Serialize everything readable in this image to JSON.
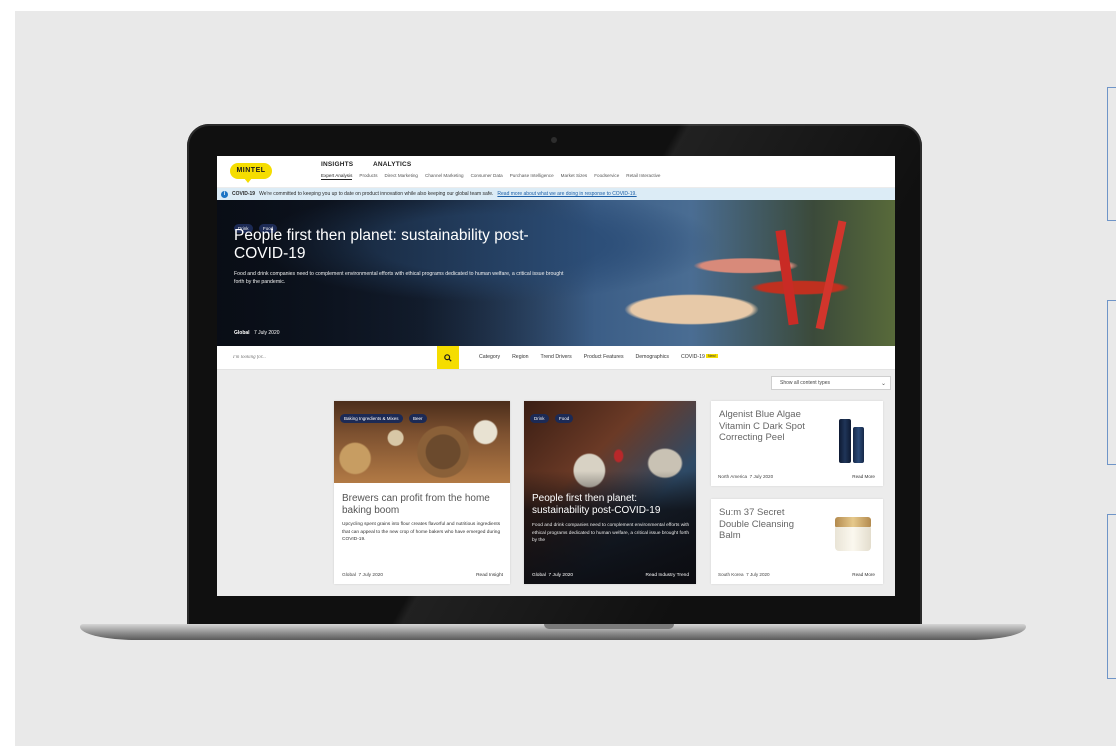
{
  "nav": {
    "logo": "MINTEL",
    "insights": "INSIGHTS",
    "analytics": "ANALYTICS",
    "subnav": [
      "Expert Analysis",
      "Products",
      "Direct Marketing",
      "Channel Marketing",
      "Consumer Data",
      "Purchase Intelligence",
      "Market Sizes",
      "Foodservice",
      "Retail Interactive"
    ]
  },
  "covid_banner": {
    "label": "COVID-19",
    "text": "We're committed to keeping you up to date on product innovation while also keeping our global team safe.",
    "link": "Read more about what we are doing in response to COVID-19."
  },
  "hero": {
    "tags": [
      "Drink",
      "Food"
    ],
    "title": "People first then planet: sustainability post-COVID-19",
    "description": "Food and drink companies need to complement environmental efforts with ethical programs dedicated to human welfare, a critical issue brought forth by the pandemic.",
    "region": "Global",
    "date": "7 July 2020"
  },
  "search": {
    "placeholder": "I'm looking for...",
    "filters": [
      "Category",
      "Region",
      "Trend Drivers",
      "Product Features",
      "Demographics",
      "COVID-19"
    ],
    "new_badge": "New!"
  },
  "content_type_select": "Show all content types",
  "cards": [
    {
      "tags": [
        "Baking Ingredients & Mixes",
        "Beer"
      ],
      "title": "Brewers can profit from the home baking boom",
      "description": "Upcycling spent grains into flour creates flavorful and nutritious ingredients that can appeal to the new crop of home bakers who have emerged during COVID-19.",
      "region": "Global",
      "date": "7 July 2020",
      "action": "Read Insight"
    },
    {
      "tags": [
        "Drink",
        "Food"
      ],
      "title": "People first then planet: sustainability post-COVID-19",
      "description": "Food and drink companies need to complement environmental efforts with ethical programs dedicated to human welfare, a critical issue brought forth by the",
      "region": "Global",
      "date": "7 July 2020",
      "action": "Read Industry Trend"
    }
  ],
  "products": [
    {
      "title": "Algenist Blue Algae Vitamin C Dark Spot Correcting Peel",
      "region": "North America",
      "date": "7 July 2020",
      "action": "Read More"
    },
    {
      "title": "Su:m 37 Secret Double Cleansing Balm",
      "region": "South Korea",
      "date": "7 July 2020",
      "action": "Read More"
    }
  ],
  "colors": {
    "brand_yellow": "#f5dd00",
    "tag_navy": "#1c2a55",
    "banner_blue": "#dcecf6"
  }
}
